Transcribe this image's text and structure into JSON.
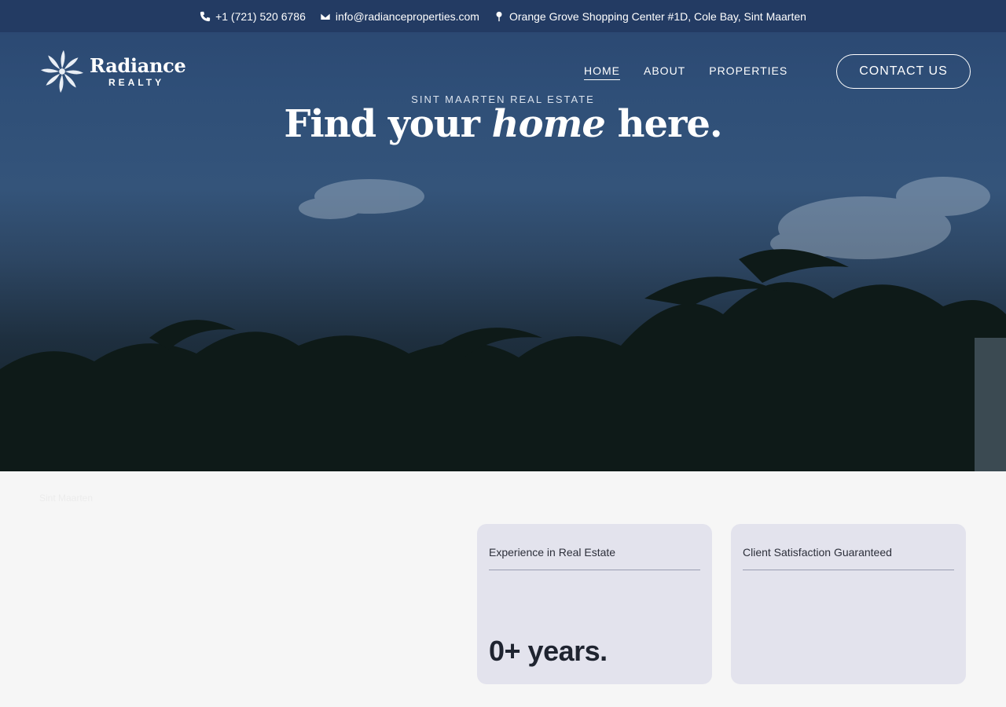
{
  "topbar": {
    "phone": "+1 (721) 520 6786",
    "email": "info@radianceproperties.com",
    "address": "Orange Grove Shopping Center #1D, Cole Bay, Sint Maarten"
  },
  "brand": {
    "name": "Radiance",
    "sub": "REALTY"
  },
  "nav": {
    "home": "HOME",
    "about": "ABOUT",
    "properties": "PROPERTIES",
    "contact": "CONTACT US"
  },
  "hero": {
    "eyebrow": "SINT MAARTEN REAL ESTATE",
    "headline_pre": "Find your ",
    "headline_em": "home",
    "headline_post": " here."
  },
  "lower": {
    "faint_text": "Sint Maarten",
    "cards": [
      {
        "label": "Experience in Real Estate",
        "value": "0+ years."
      },
      {
        "label": "Client Satisfaction Guaranteed",
        "value": ""
      }
    ]
  },
  "colors": {
    "topbar": "#233b63",
    "card_bg": "#e3e3ed",
    "page_bg": "#f6f6f6"
  }
}
